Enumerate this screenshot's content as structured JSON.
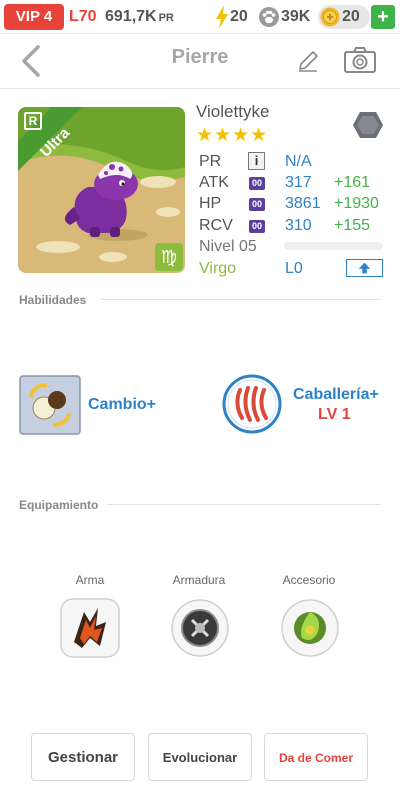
{
  "status": {
    "vip": "VIP 4",
    "level": "L70",
    "pr_value": "691,7K",
    "pr_unit": "PR",
    "energy": "20",
    "paws": "39K",
    "coins": "20",
    "add_label": "+"
  },
  "header": {
    "title": "Pierre"
  },
  "monster": {
    "rarity_badge": "R",
    "rarity": "Ultra",
    "name": "Violettyke",
    "stars": "★★★★",
    "sign_symbol": "♍",
    "element_icon": "rock-element-icon"
  },
  "stats": {
    "pr_label": "PR",
    "pr_info": "i",
    "pr_value": "N/A",
    "atk_label": "ATK",
    "atk_badge": "00",
    "atk_value": "317",
    "atk_bonus": "+161",
    "hp_label": "HP",
    "hp_badge": "00",
    "hp_value": "3861",
    "hp_bonus": "+1930",
    "rcv_label": "RCV",
    "rcv_badge": "00",
    "rcv_value": "310",
    "rcv_bonus": "+155",
    "level_label": "Nivel 05",
    "level_progress": 0,
    "sign": "Virgo",
    "loyalty": "L0"
  },
  "skills": {
    "title": "Habilidades",
    "skill1": "Cambio+",
    "skill2": "Caballería+",
    "skill2_level": "LV 1"
  },
  "equipment": {
    "title": "Equipamiento",
    "weapon": "Arma",
    "armor": "Armadura",
    "accessory": "Accesorio"
  },
  "buttons": {
    "manage": "Gestionar",
    "evolve": "Evolucionar",
    "feed": "Da de Comer"
  },
  "colors": {
    "vip_red": "#e8433a",
    "blue": "#2e82c8",
    "green": "#44b048",
    "purple_badge": "#5a3ea0",
    "star_yellow": "#f2c200"
  }
}
